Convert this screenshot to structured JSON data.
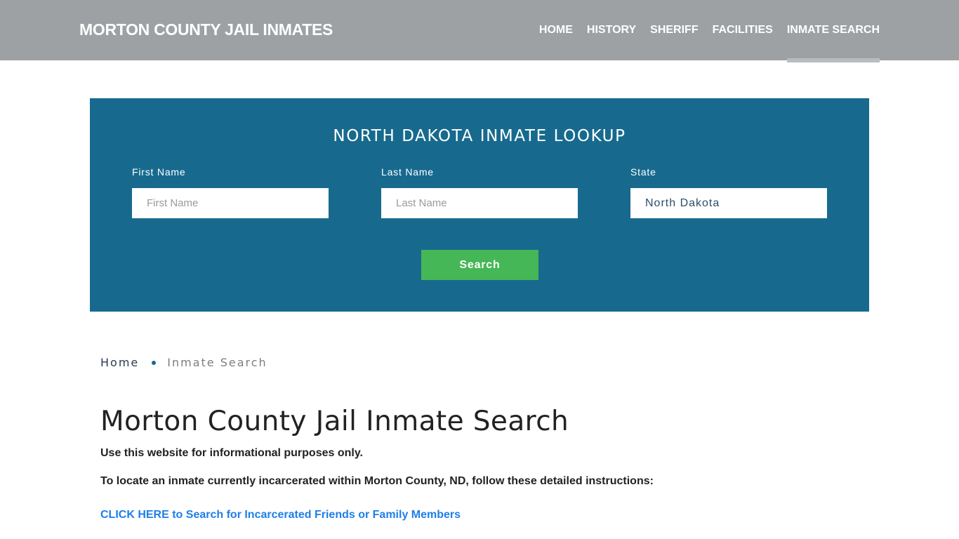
{
  "header": {
    "brand": "MORTON COUNTY JAIL INMATES",
    "nav": [
      {
        "label": "HOME",
        "active": false
      },
      {
        "label": "HISTORY",
        "active": false
      },
      {
        "label": "SHERIFF",
        "active": false
      },
      {
        "label": "FACILITIES",
        "active": false
      },
      {
        "label": "INMATE SEARCH",
        "active": true
      }
    ]
  },
  "lookup": {
    "title": "NORTH DAKOTA INMATE LOOKUP",
    "first_name": {
      "label": "First Name",
      "placeholder": "First Name",
      "value": ""
    },
    "last_name": {
      "label": "Last Name",
      "placeholder": "Last Name",
      "value": ""
    },
    "state": {
      "label": "State",
      "value": "North Dakota"
    },
    "search_label": "Search"
  },
  "breadcrumb": {
    "home": "Home",
    "current": "Inmate Search"
  },
  "content": {
    "title": "Morton County Jail Inmate Search",
    "paragraph1": "Use this website for informational purposes only.",
    "paragraph2": "To locate an inmate currently incarcerated within Morton County, ND, follow these detailed instructions:",
    "cta_link": "CLICK HERE to Search for Incarcerated Friends or Family Members"
  },
  "colors": {
    "header_bg": "#9da1a4",
    "lookup_bg": "#176a8e",
    "button_green": "#45b756",
    "link_blue": "#1e7ee8"
  }
}
